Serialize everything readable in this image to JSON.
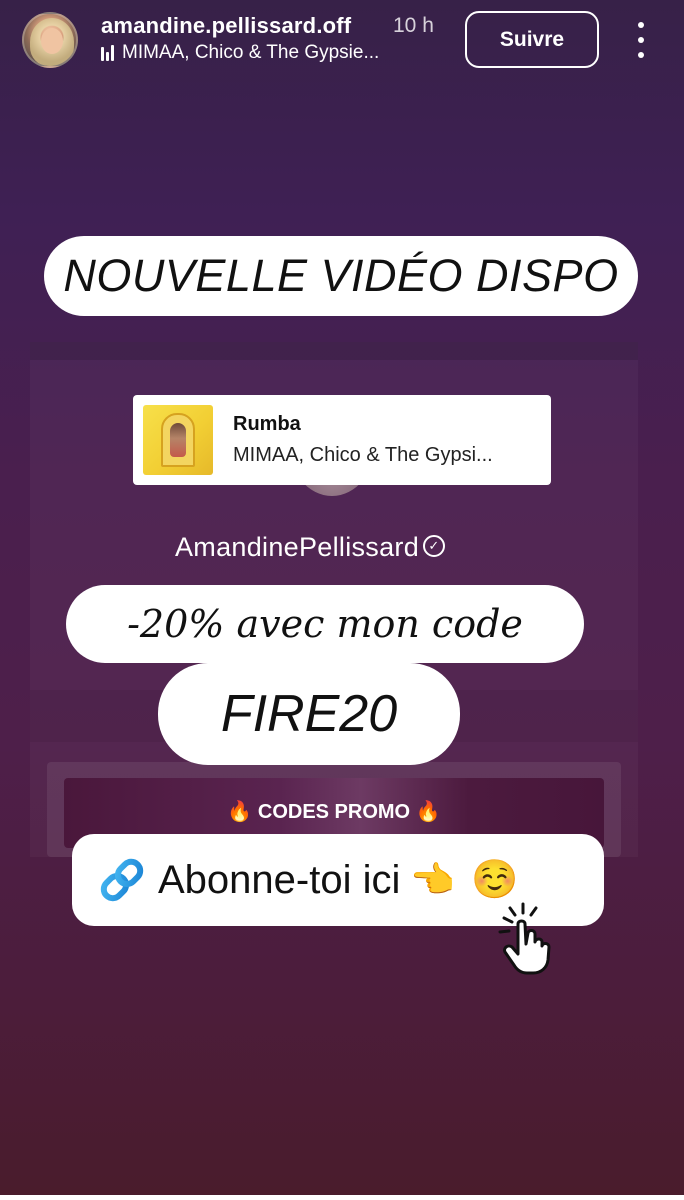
{
  "header": {
    "username": "amandine.pellissard.off",
    "time_ago": "10 h",
    "music_line": "MIMAA, Chico & The Gypsie...",
    "follow_label": "Suivre",
    "icons": {
      "avatar": "profile-avatar",
      "music": "equalizer-icon",
      "more": "more-vertical-icon"
    }
  },
  "stickers": {
    "video_label": "NOUVELLE VIDÉO DISPO",
    "discount_label": "-20% avec mon code",
    "code_label": "FIRE20",
    "subscribe_label": "Abonne-toi ici",
    "subscribe_emojis": [
      "👈",
      "☺️"
    ]
  },
  "music_sticker": {
    "title": "Rumba",
    "artist": "MIMAA, Chico & The Gypsi..."
  },
  "embedded_screen": {
    "profile_name": "AmandinePellissard",
    "promo_banner": "🔥 CODES PROMO 🔥"
  },
  "colors": {
    "background_top": "#372148",
    "background_bottom": "#4a1c2c",
    "sticker": "#ffffff",
    "text_dark": "#111111"
  }
}
